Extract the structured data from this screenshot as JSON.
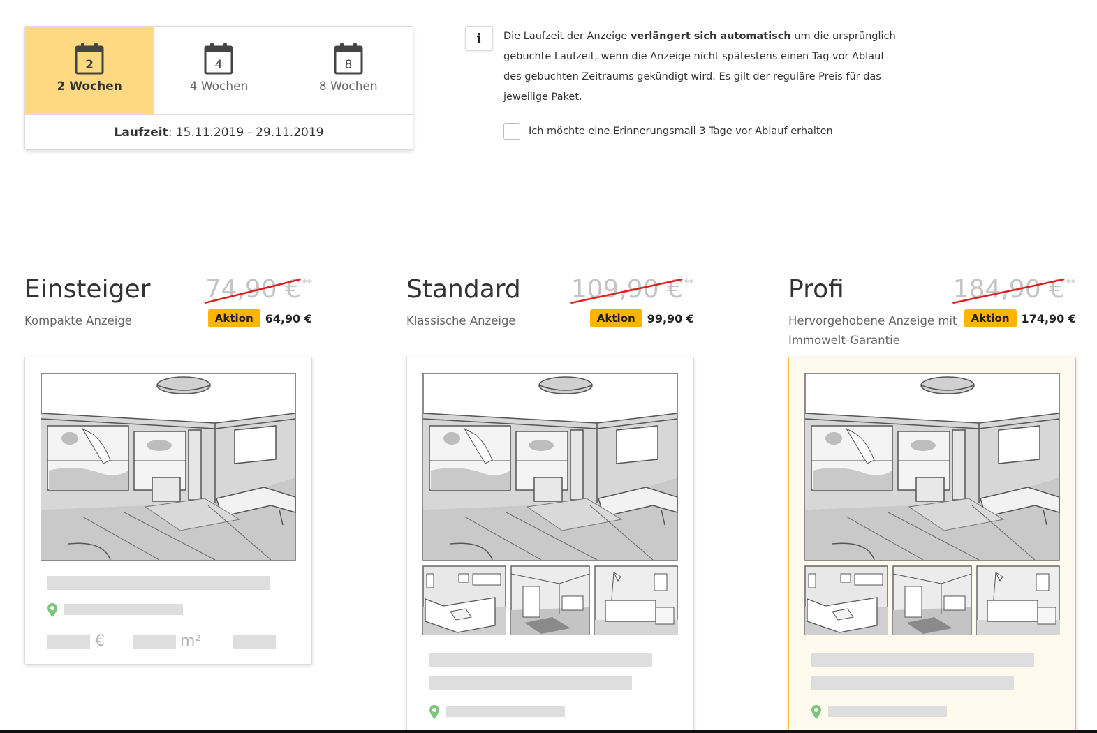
{
  "duration": {
    "options": [
      {
        "number": "2",
        "label": "2 Wochen",
        "active": true
      },
      {
        "number": "4",
        "label": "4 Wochen",
        "active": false
      },
      {
        "number": "8",
        "label": "8 Wochen",
        "active": false
      }
    ],
    "runtime_label": "Laufzeit",
    "runtime_value": ": 15.11.2019 - 29.11.2019"
  },
  "info": {
    "icon": "info-icon",
    "text_part1": "Die Laufzeit der Anzeige ",
    "text_bold": "verlängert sich automatisch",
    "text_part2": " um die ursprünglich gebuchte Laufzeit, wenn die Anzeige nicht spätestens einen Tag vor Ablauf des gebuchten Zeitraums gekündigt wird. Es gilt der reguläre Preis für das jeweilige Paket.",
    "reminder_label": "Ich möchte eine Erinnerungsmail 3 Tage vor Ablauf erhalten",
    "reminder_checked": false
  },
  "packages": [
    {
      "title": "Einsteiger",
      "subtitle": "Kompakte Anzeige",
      "old_price": "74,90 €",
      "old_price_note": "**",
      "badge": "Aktion",
      "new_price": "64,90 €",
      "highlight": false
    },
    {
      "title": "Standard",
      "subtitle": "Klassische Anzeige",
      "old_price": "109,90 €",
      "old_price_note": "**",
      "badge": "Aktion",
      "new_price": "99,90 €",
      "highlight": false
    },
    {
      "title": "Profi",
      "subtitle": "Hervorgehobene Anzeige mit Immowelt-Garantie",
      "old_price": "184,90 €",
      "old_price_note": "**",
      "badge": "Aktion",
      "new_price": "174,90 €",
      "highlight": true
    }
  ],
  "preview": {
    "currency_unit": "€",
    "area_unit": "m²"
  },
  "colors": {
    "active_tab": "#ffd982",
    "badge": "#ffb400",
    "strike": "#e02020",
    "highlight_card": "#fffaed",
    "pin": "#7dc47d"
  }
}
